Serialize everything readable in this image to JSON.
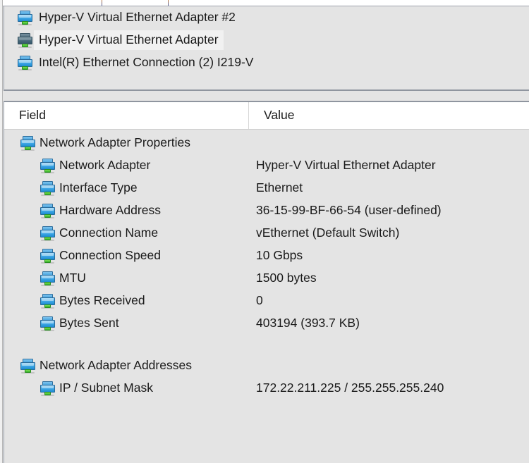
{
  "adapter_list": {
    "name": "network-adapter-list",
    "items": [
      {
        "label": "Hyper-V Virtual Ethernet Adapter #2",
        "icon": "network-adapter-icon",
        "selected": false
      },
      {
        "label": "Hyper-V Virtual Ethernet Adapter",
        "icon": "network-adapter-icon",
        "selected": true
      },
      {
        "label": "Intel(R) Ethernet Connection (2) I219-V",
        "icon": "network-adapter-icon",
        "selected": false
      }
    ]
  },
  "grid": {
    "columns": {
      "field": "Field",
      "value": "Value"
    },
    "groups": [
      {
        "title": "Network Adapter Properties",
        "icon": "network-adapter-icon",
        "rows": [
          {
            "field": "Network Adapter",
            "value": "Hyper-V Virtual Ethernet Adapter",
            "icon": "network-adapter-icon"
          },
          {
            "field": "Interface Type",
            "value": "Ethernet",
            "icon": "network-adapter-icon"
          },
          {
            "field": "Hardware Address",
            "value": "36-15-99-BF-66-54  (user-defined)",
            "icon": "network-adapter-icon"
          },
          {
            "field": "Connection Name",
            "value": "vEthernet (Default Switch)",
            "icon": "network-adapter-icon"
          },
          {
            "field": "Connection Speed",
            "value": "10 Gbps",
            "icon": "network-adapter-icon"
          },
          {
            "field": "MTU",
            "value": "1500 bytes",
            "icon": "network-adapter-icon"
          },
          {
            "field": "Bytes Received",
            "value": "0",
            "icon": "network-adapter-icon"
          },
          {
            "field": "Bytes Sent",
            "value": "403194 (393.7 KB)",
            "icon": "network-adapter-icon"
          }
        ]
      },
      {
        "title": "Network Adapter Addresses",
        "icon": "network-adapter-icon",
        "rows": [
          {
            "field": "IP / Subnet Mask",
            "value": "172.22.211.225 / 255.255.255.240",
            "icon": "network-adapter-icon"
          }
        ]
      }
    ]
  },
  "colors": {
    "panel_background": "#e4e4e4",
    "header_background": "#ffffff",
    "selection_background": "#f1f1f1",
    "text": "#1a1a1a",
    "divider": "#8f959f",
    "icon_blue": "#39a4e4",
    "icon_green": "#34b328"
  }
}
